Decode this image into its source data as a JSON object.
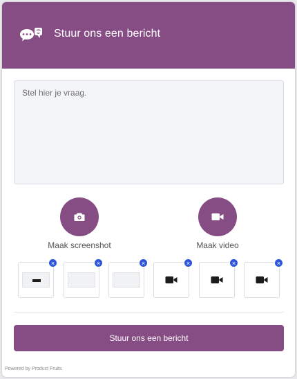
{
  "header": {
    "title": "Stuur ons een bericht",
    "icon": "chat-bubbles-icon"
  },
  "message": {
    "placeholder": "Stel hier je vraag.",
    "value": ""
  },
  "capture": {
    "screenshot_label": "Maak screenshot",
    "video_label": "Maak video"
  },
  "attachments": [
    {
      "type": "screenshot",
      "remove": "×"
    },
    {
      "type": "screenshot",
      "remove": "×"
    },
    {
      "type": "screenshot",
      "remove": "×"
    },
    {
      "type": "video",
      "remove": "×"
    },
    {
      "type": "video",
      "remove": "×"
    },
    {
      "type": "video",
      "remove": "×"
    }
  ],
  "submit_label": "Stuur ons een bericht",
  "powered_by": "Powered by Product Fruits",
  "colors": {
    "brand": "#864d84",
    "remove_badge": "#2f56d8"
  }
}
